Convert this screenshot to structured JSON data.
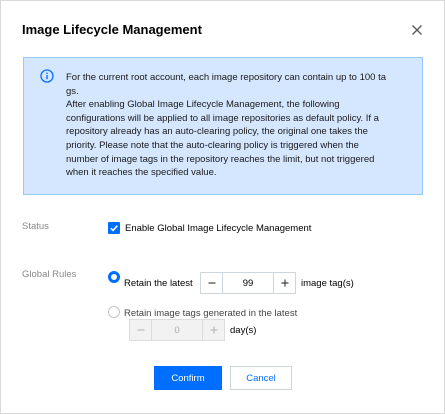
{
  "dialog": {
    "title": "Image Lifecycle Management",
    "close_icon": "close-icon"
  },
  "notice": {
    "icon": "info-icon",
    "lines": [
      "For the current root account, each image repository can contain up to 100 ta",
      "gs.",
      "After enabling Global Image Lifecycle Management, the following",
      "configurations will be applied to all image repositories as default policy. If a",
      "repository already has an auto-clearing policy, the original one takes the",
      "priority. Please note that the auto-clearing policy is triggered when the",
      "number of image tags in the repository reaches the limit, but not triggered",
      "when it reaches the specified value."
    ]
  },
  "status": {
    "label": "Status",
    "checkbox_label": "Enable Global Image Lifecycle Management",
    "checked": true
  },
  "rules": {
    "label": "Global Rules",
    "option_latest": {
      "label": "Retain the latest",
      "value": "99",
      "unit": "image tag(s)",
      "selected": true
    },
    "option_days": {
      "label": "Retain image tags generated in the latest",
      "value": "0",
      "unit": "day(s)",
      "selected": false
    }
  },
  "footer": {
    "confirm": "Confirm",
    "cancel": "Cancel"
  },
  "colors": {
    "accent": "#006eff",
    "notice_bg": "#d5e7ff",
    "notice_border": "#97c7ff"
  }
}
